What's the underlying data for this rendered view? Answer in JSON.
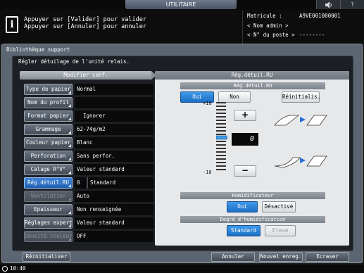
{
  "header": {
    "title": "UTILITAIRE",
    "speaker_icon": "speaker-icon",
    "help_label": "?"
  },
  "message": {
    "line1": "Appuyer sur [Valider] pour valider",
    "line2": "Appuyer sur [Annuler] pour annuler"
  },
  "device_info": {
    "serial_label": "Matricule :",
    "serial_value": "A9VE001000001",
    "admin_label": "< Nom admin >",
    "post_label": "< N° du poste >",
    "post_value": "--------"
  },
  "window": {
    "title": "Bibliothèque support",
    "subtitle": "Régler détuilage de l'unité relais."
  },
  "left_panel": {
    "heading": "Modifier conf.",
    "rows": [
      {
        "label": "Type de papier",
        "value": "Normal",
        "state": "normal"
      },
      {
        "label": "Nom du profil",
        "value": "",
        "state": "normal"
      },
      {
        "label": "Format papier",
        "value": "Ignorer",
        "state": "normal"
      },
      {
        "label": "Grammage",
        "value": "62-74g/m2",
        "state": "normal"
      },
      {
        "label": "Couleur papier",
        "value": "Blanc",
        "state": "normal"
      },
      {
        "label": "Perforation",
        "value": "Sans perfor.",
        "state": "normal"
      },
      {
        "label": "Calage R°V°",
        "value": "Valeur standard",
        "state": "normal"
      },
      {
        "label": "Rég.détuil.RU",
        "value_num": "0",
        "value": "Standard",
        "state": "selected"
      },
      {
        "label": "Ventilation",
        "value": "Auto",
        "state": "disabled"
      },
      {
        "label": "Epaisseur",
        "value": "Non renseignée",
        "state": "normal"
      },
      {
        "label": "Réglages expert",
        "value": "Valeur standard",
        "state": "normal"
      },
      {
        "label": "Densité couleur",
        "value": "OFF",
        "state": "disabled"
      }
    ]
  },
  "right_panel": {
    "heading": "Rég.détuil.RU",
    "section_heading": "Rég.détuil.RU",
    "on_label": "Oui",
    "off_label": "Non",
    "reset_label": "Réinitialis.",
    "scale_max": "+10",
    "scale_min": "-10",
    "current_value": "0",
    "plus_label": "+",
    "minus_label": "−",
    "humidifier": {
      "heading": "Humidificateur",
      "on_label": "Oui",
      "off_label": "Désactivé"
    },
    "humidity_level": {
      "heading": "Degré d'humidification",
      "standard_label": "Standard",
      "high_label": "Elevé"
    }
  },
  "footer": {
    "reset_label": "Réinitialiser",
    "cancel_label": "Annuler",
    "new_save_label": "Nouvel enreg.",
    "overwrite_label": "Ecraser",
    "time": "10:40"
  },
  "colors": {
    "accent": "#1c6fc7",
    "panel": "#5c6672"
  }
}
